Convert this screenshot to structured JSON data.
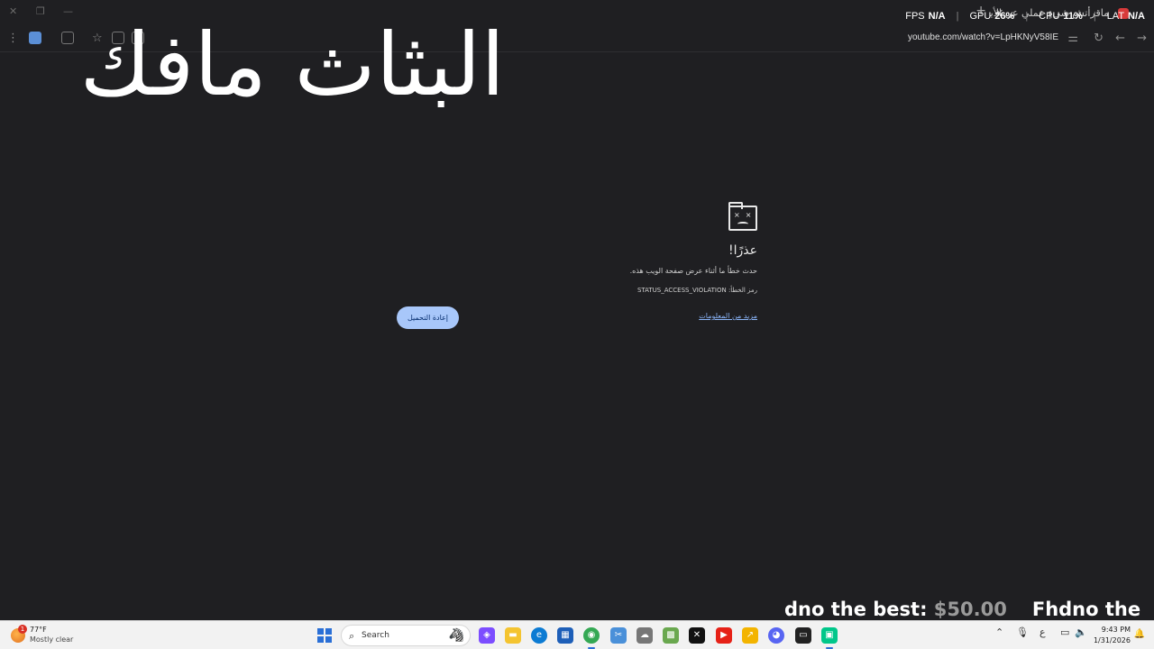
{
  "browser": {
    "tab_title": "ماقرأتش شيءٍ عملي عن الأيدي",
    "url": "youtube.com/watch?v=LpHKNyV58IE",
    "controls": {
      "minimize": "—",
      "restore": "❐",
      "close": "✕",
      "new_tab": "+",
      "tab_close": "✕",
      "menu": "⋮",
      "star": "☆",
      "reload": "↻",
      "back": "←",
      "forward": "→",
      "site_info": "⚌"
    }
  },
  "hud": {
    "fps_label": "FPS",
    "fps_value": "N/A",
    "gpu_label": "GPU",
    "gpu_value": "26%",
    "cpu_label": "CPU",
    "cpu_value": "11%",
    "lat_label": "LAT",
    "lat_value": "N/A"
  },
  "overlay_text": "البثاث مافك",
  "error": {
    "title": "عذرًا!",
    "description": "حدث خطأ ما أثناء عرض صفحة الويب هذه.",
    "code_label": "رمز الخطأ:",
    "code": "STATUS_ACCESS_VIOLATION",
    "learn_more": "مزيد من المعلومات",
    "reload_button": "إعادة التحميل"
  },
  "ticker": {
    "segments": [
      {
        "text": "dno the best: ",
        "price": "$50.00"
      },
      {
        "text": "Fhdno the",
        "price": ""
      }
    ]
  },
  "taskbar": {
    "weather_badge": "1",
    "temperature": "77°F",
    "condition": "Mostly clear",
    "search_placeholder": "Search",
    "time": "9:43 PM",
    "date": "1/31/2026",
    "tray_lang": "ع"
  },
  "colors": {
    "page_bg": "#1f1f22",
    "link": "#8ab4f8",
    "button_bg": "#a8c7fa",
    "taskbar_bg": "#f2f2f2"
  }
}
